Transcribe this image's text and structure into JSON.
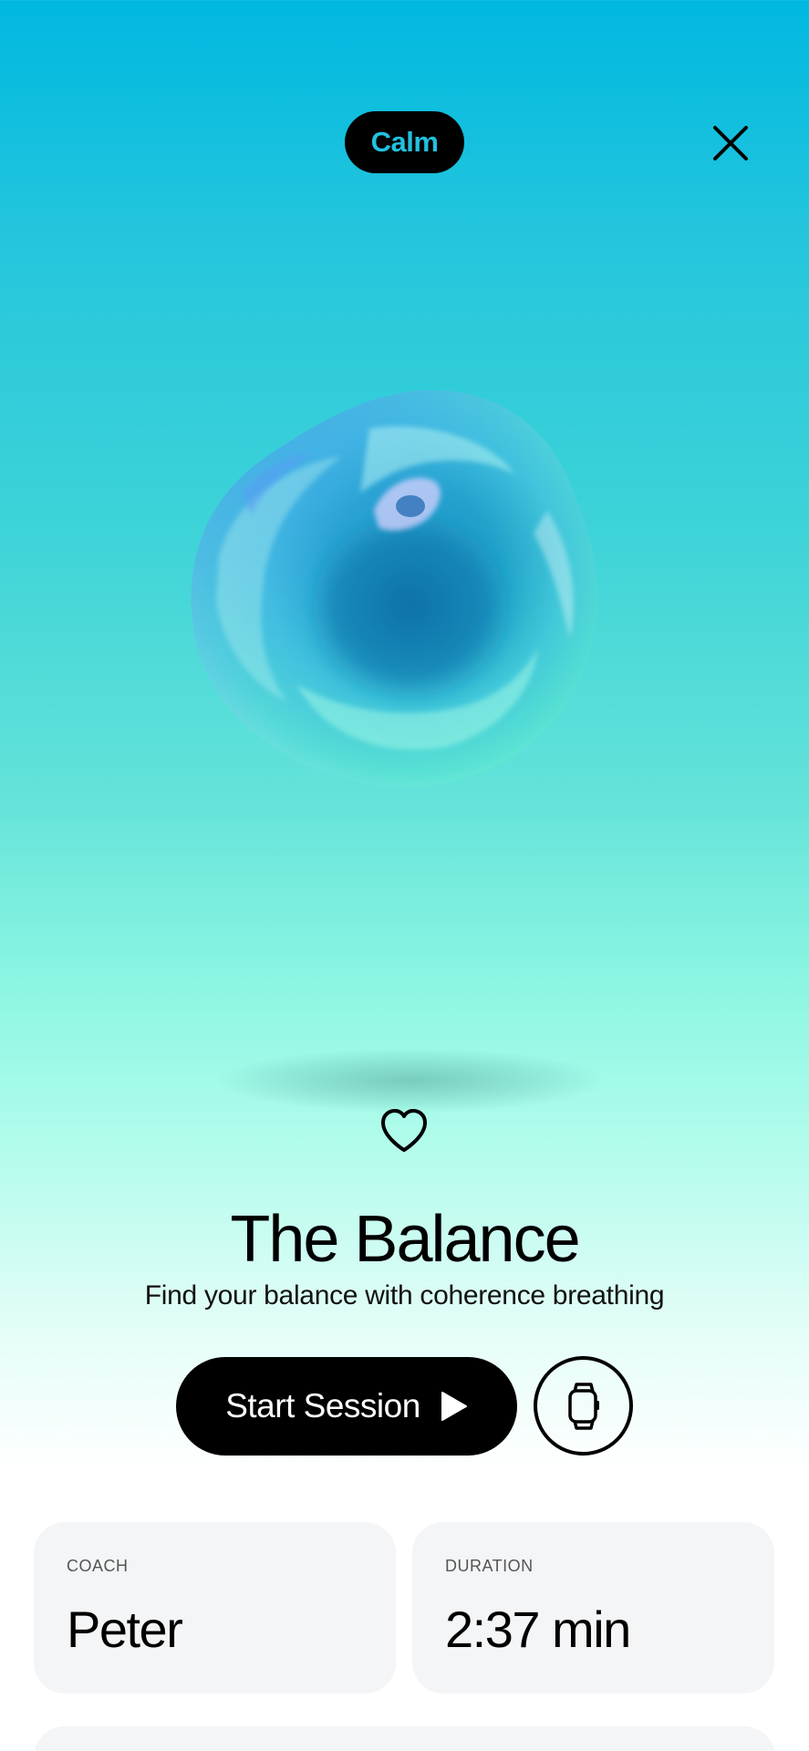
{
  "header": {
    "tag_label": "Calm",
    "close_icon": "close-icon"
  },
  "exercise": {
    "title": "The Balance",
    "subtitle": "Find your balance with coherence breathing",
    "favorite_icon": "heart-outline-icon"
  },
  "actions": {
    "start_label": "Start Session",
    "start_icon": "play-icon",
    "watch_icon": "smartwatch-icon"
  },
  "details": {
    "coach": {
      "label": "COACH",
      "value": "Peter"
    },
    "duration": {
      "label": "DURATION",
      "value": "2:37 min"
    }
  },
  "colors": {
    "accent": "#22c0df",
    "background_top": "#00b8e0",
    "background_mid": "#8ff7e3",
    "button": "#000000",
    "card_bg": "#f4f5f7"
  }
}
